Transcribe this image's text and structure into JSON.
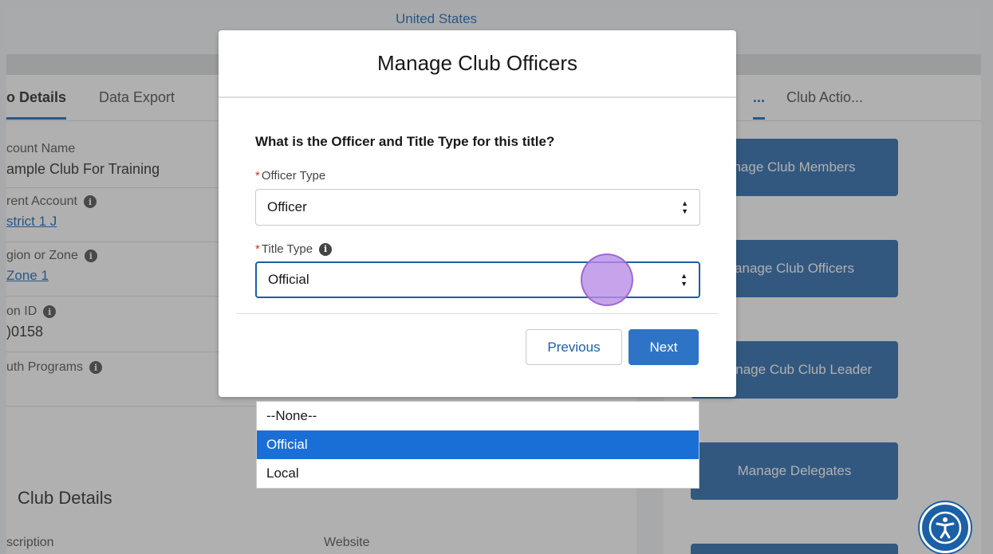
{
  "header": {
    "country": "United States"
  },
  "left_tabs": [
    {
      "label": "o Details"
    },
    {
      "label": "Data Export"
    }
  ],
  "fields": [
    {
      "label": "count Name",
      "value": "ample Club For Training"
    },
    {
      "label": "rent Account",
      "value": "strict 1 J"
    },
    {
      "label": "gion or Zone",
      "value": "Zone 1"
    },
    {
      "label": "on ID",
      "value": ")0158"
    },
    {
      "label": "uth Programs",
      "value": ""
    }
  ],
  "section": {
    "title": "Club Details",
    "description_label": "scription",
    "website_label": "Website"
  },
  "right_tabs": [
    {
      "label": "..."
    },
    {
      "label": "Club Actio..."
    }
  ],
  "actions": [
    {
      "label": "nage Club Members"
    },
    {
      "label": "anage Club Officers"
    },
    {
      "label": "Manage Cub Club Leader"
    },
    {
      "label": "Manage Delegates"
    }
  ],
  "modal": {
    "title": "Manage Club Officers",
    "question": "What is the Officer and Title Type for this title?",
    "officer_type": {
      "required_mark": "*",
      "label": "Officer Type",
      "value": "Officer"
    },
    "title_type": {
      "required_mark": "*",
      "label": "Title Type",
      "value": "Official"
    },
    "previous_label": "Previous",
    "next_label": "Next"
  },
  "dropdown": {
    "options": [
      "--None--",
      "Official",
      "Local"
    ],
    "selected": "Official"
  },
  "colors": {
    "brand": "#1b5fa6",
    "selected": "#1a6fd6",
    "required": "#c23934"
  }
}
